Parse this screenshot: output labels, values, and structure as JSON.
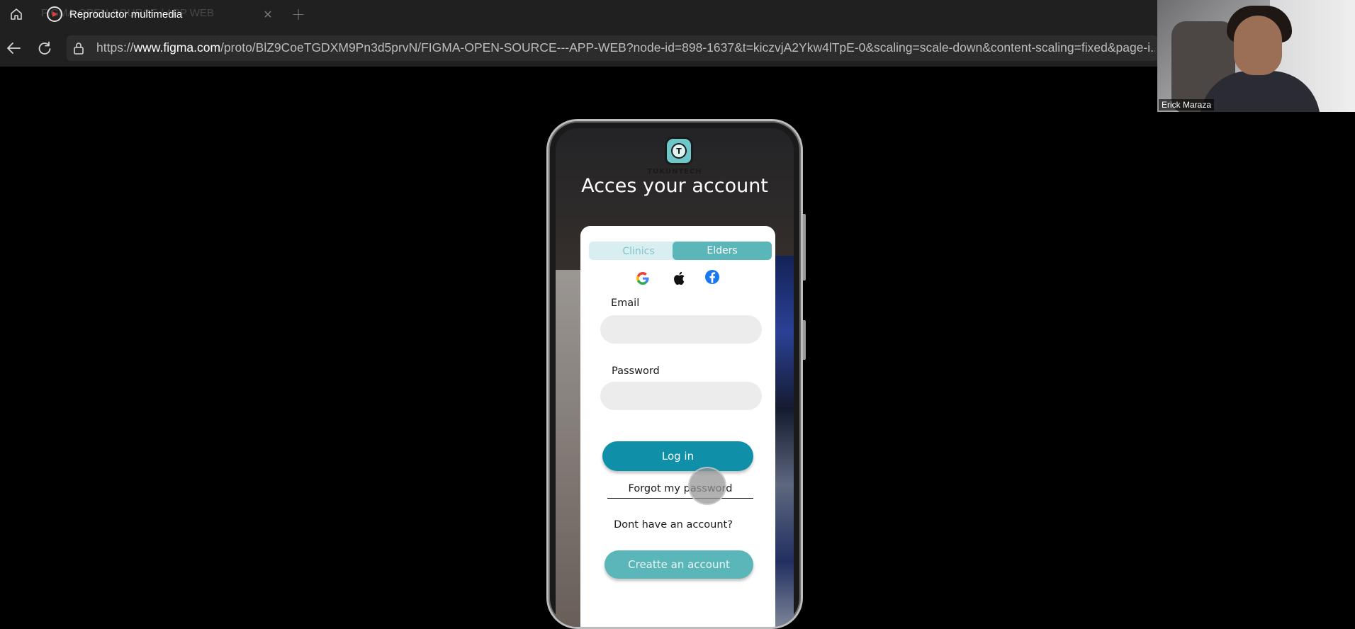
{
  "browser": {
    "ghost_tab_title": "FIGMA-OPEN-SOURCE / APP WEB",
    "media_overlay_title": "Reproductor multimedia",
    "url_prefix": "https://",
    "url_domain": "www.figma.com",
    "url_path": "/proto/BlZ9CoeTGDXM9Pn3d5prvN/FIGMA-OPEN-SOURCE---APP-WEB?node-id=898-1637&t=kiczvjA2Ykw4lTpE-0&scaling=scale-down&content-scaling=fixed&page-i..."
  },
  "webcam": {
    "participant_name": "Erick Maraza"
  },
  "app": {
    "brand": "TUKUNTECH",
    "logo_letter": "T",
    "heading": "Acces your account",
    "tabs": {
      "clinics": "Clinics",
      "elders": "Elders",
      "selected": "Elders"
    },
    "social_icons": [
      "google-icon",
      "apple-icon",
      "facebook-icon"
    ],
    "email_label": "Email",
    "password_label": "Password",
    "login_label": "Log in",
    "forgot_label": "Forgot my password",
    "no_account_label": "Dont have an account?",
    "create_label": "Creatte an account",
    "colors": {
      "primary": "#0f90a8",
      "secondary": "#5ab6b9",
      "tab_bg": "#d8eef0"
    }
  }
}
